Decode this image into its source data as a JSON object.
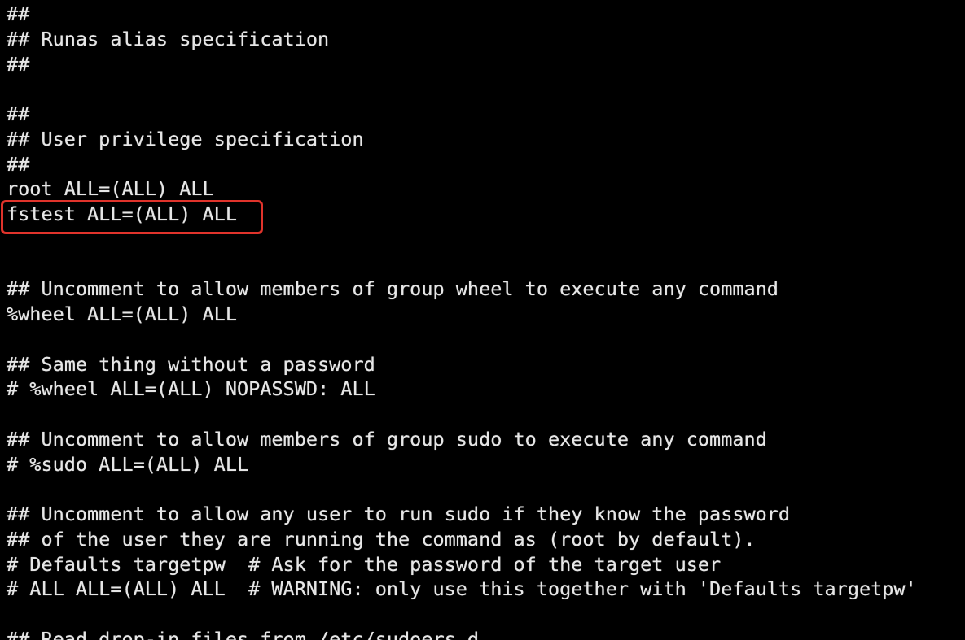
{
  "terminal": {
    "lines": [
      "##",
      "## Runas alias specification",
      "##",
      "",
      "##",
      "## User privilege specification",
      "##",
      "root ALL=(ALL) ALL",
      "fstest ALL=(ALL) ALL",
      "",
      "",
      "## Uncomment to allow members of group wheel to execute any command",
      "%wheel ALL=(ALL) ALL",
      "",
      "## Same thing without a password",
      "# %wheel ALL=(ALL) NOPASSWD: ALL",
      "",
      "## Uncomment to allow members of group sudo to execute any command",
      "# %sudo ALL=(ALL) ALL",
      "",
      "## Uncomment to allow any user to run sudo if they know the password",
      "## of the user they are running the command as (root by default).",
      "# Defaults targetpw  # Ask for the password of the target user",
      "# ALL ALL=(ALL) ALL  # WARNING: only use this together with 'Defaults targetpw'",
      "",
      "## Read drop-in files from /etc/sudoers.d"
    ],
    "highlighted_line": "fstest ALL=(ALL) ALL",
    "colors": {
      "background": "#000000",
      "text": "#e6e6e6",
      "highlight_border": "#e0332b"
    }
  }
}
